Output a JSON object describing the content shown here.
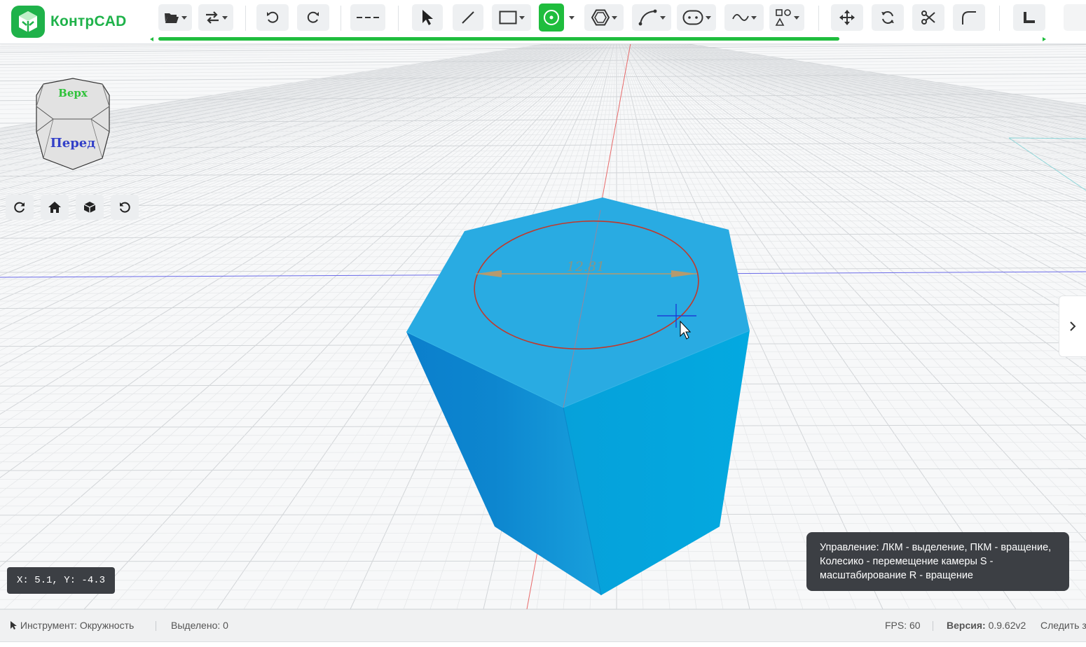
{
  "app": {
    "name": "КонтрCAD"
  },
  "toolbar": {
    "tools": [
      {
        "name": "open-file",
        "icon": "folder-open-icon",
        "has_menu": true
      },
      {
        "name": "import-export",
        "icon": "swap-arrows-icon",
        "has_menu": true
      },
      {
        "name": "undo",
        "icon": "undo-icon"
      },
      {
        "name": "redo",
        "icon": "redo-icon"
      },
      {
        "name": "line-style",
        "icon": "dashed-line-icon"
      },
      {
        "name": "select",
        "icon": "cursor-arrow-icon"
      },
      {
        "name": "line",
        "icon": "line-icon"
      },
      {
        "name": "rectangle",
        "icon": "rectangle-icon",
        "has_menu": true
      },
      {
        "name": "circle",
        "icon": "circle-center-icon",
        "has_menu": true,
        "active": true
      },
      {
        "name": "polygon",
        "icon": "hexagon-icon",
        "has_menu": true
      },
      {
        "name": "arc",
        "icon": "arc-icon",
        "has_menu": true
      },
      {
        "name": "slot",
        "icon": "slot-icon",
        "has_menu": true
      },
      {
        "name": "spline",
        "icon": "spline-wave-icon",
        "has_menu": true
      },
      {
        "name": "primitives",
        "icon": "shapes-icon",
        "has_menu": true
      },
      {
        "name": "move",
        "icon": "move-arrows-icon"
      },
      {
        "name": "rotate",
        "icon": "rotate-icon"
      },
      {
        "name": "trim",
        "icon": "scissors-icon"
      },
      {
        "name": "fillet",
        "icon": "fillet-icon"
      },
      {
        "name": "measure",
        "icon": "ruler-corner-icon"
      }
    ],
    "accent_color": "#1fbd3d",
    "progress": 0.77
  },
  "viewcube": {
    "top_label": "Верх",
    "front_label": "Перед",
    "top_color": "#2fc23a",
    "front_color": "#3340c8"
  },
  "camera_buttons": [
    {
      "name": "refresh-view",
      "icon": "refresh-icon"
    },
    {
      "name": "home-view",
      "icon": "home-icon"
    },
    {
      "name": "iso-view",
      "icon": "cube-icon"
    },
    {
      "name": "reset-view",
      "icon": "reset-icon"
    }
  ],
  "scene": {
    "dimension_value": "12.81",
    "solid_color": "#29abe2",
    "sketch_circle_color": "#c0392b",
    "x_axis_color": "#6a6ae8",
    "y_axis_color": "#e86a6a"
  },
  "coords": {
    "text": "X: 5.1, Y: -4.3"
  },
  "help": {
    "text": "Управление: ЛКМ - выделение, ПКМ - вращение, Колесико - перемещение камеры S - масштабирование R - вращение"
  },
  "status": {
    "tool": "Инструмент: Окружность",
    "selected": "Выделено: 0",
    "fps": "FPS: 60",
    "version_label": "Версия:",
    "version_value": "0.9.62v2",
    "follow": "Следить з"
  }
}
